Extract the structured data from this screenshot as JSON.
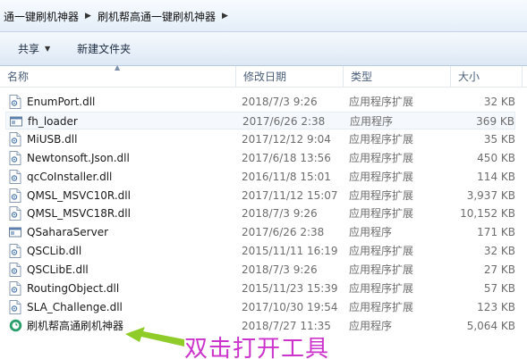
{
  "breadcrumb": [
    "通一键刷机神器",
    "刷机帮高通一键刷机神器"
  ],
  "toolbar": {
    "share_label": "共享",
    "new_folder_label": "新建文件夹"
  },
  "columns": {
    "name": "名称",
    "date": "修改日期",
    "type": "类型",
    "size": "大小"
  },
  "files": [
    {
      "name": "EnumPort.dll",
      "date": "2018/7/3 9:26",
      "type": "应用程序扩展",
      "size": "32 KB",
      "icon": "dll-file-icon"
    },
    {
      "name": "fh_loader",
      "date": "2017/6/26 2:38",
      "type": "应用程序",
      "size": "369 KB",
      "icon": "exe-window-icon"
    },
    {
      "name": "MiUSB.dll",
      "date": "2017/12/12 9:04",
      "type": "应用程序扩展",
      "size": "35 KB",
      "icon": "dll-file-icon"
    },
    {
      "name": "Newtonsoft.Json.dll",
      "date": "2017/6/18 13:56",
      "type": "应用程序扩展",
      "size": "450 KB",
      "icon": "dll-file-icon"
    },
    {
      "name": "qcCoInstaller.dll",
      "date": "2016/11/8 15:01",
      "type": "应用程序扩展",
      "size": "114 KB",
      "icon": "dll-file-icon"
    },
    {
      "name": "QMSL_MSVC10R.dll",
      "date": "2017/11/12 15:07",
      "type": "应用程序扩展",
      "size": "3,937 KB",
      "icon": "dll-file-icon"
    },
    {
      "name": "QMSL_MSVC18R.dll",
      "date": "2018/7/3 9:26",
      "type": "应用程序扩展",
      "size": "10,152 KB",
      "icon": "dll-file-icon"
    },
    {
      "name": "QSaharaServer",
      "date": "2017/6/26 2:38",
      "type": "应用程序",
      "size": "171 KB",
      "icon": "exe-window-icon"
    },
    {
      "name": "QSCLib.dll",
      "date": "2015/11/11 16:19",
      "type": "应用程序扩展",
      "size": "32 KB",
      "icon": "dll-file-icon"
    },
    {
      "name": "QSCLibE.dll",
      "date": "2018/7/3 9:26",
      "type": "应用程序扩展",
      "size": "27 KB",
      "icon": "dll-file-icon"
    },
    {
      "name": "RoutingObject.dll",
      "date": "2015/11/23 15:39",
      "type": "应用程序扩展",
      "size": "57 KB",
      "icon": "dll-file-icon"
    },
    {
      "name": "SLA_Challenge.dll",
      "date": "2017/10/30 19:54",
      "type": "应用程序扩展",
      "size": "123 KB",
      "icon": "dll-file-icon"
    },
    {
      "name": "刷机帮高通刷机神器",
      "date": "2018/7/27 11:35",
      "type": "应用程序",
      "size": "5,064 KB",
      "icon": "app-logo-icon"
    }
  ],
  "annotation": {
    "text": "双击打开工具",
    "color": "#cc33cc",
    "arrow_color": "#8fcc2a"
  }
}
